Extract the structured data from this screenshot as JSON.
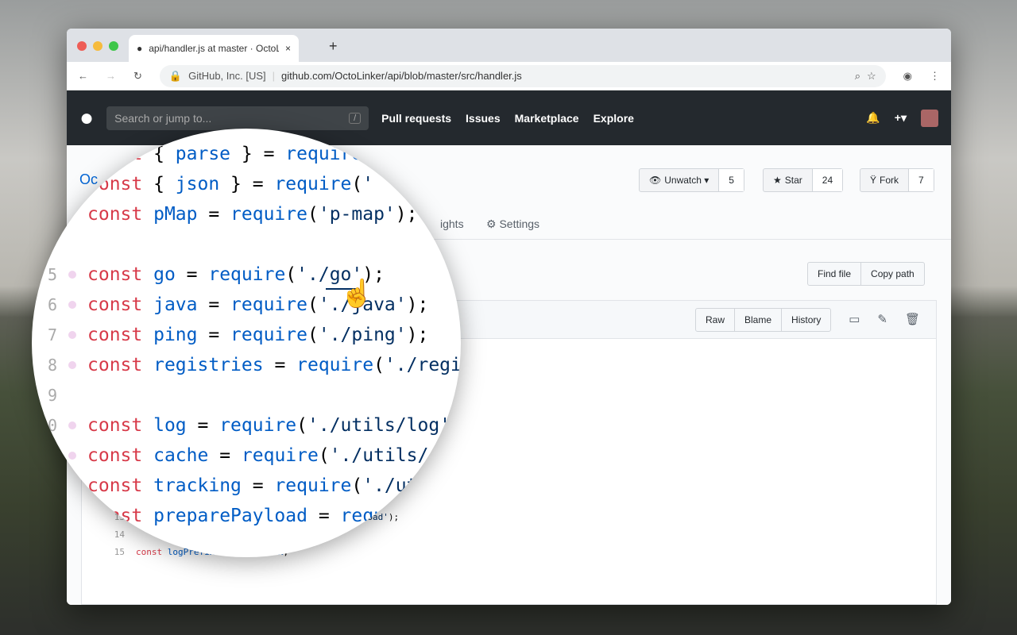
{
  "browser": {
    "tab_title": "api/handler.js at master · OctoLinker",
    "new_tab": "+",
    "close": "×",
    "site_identity": "GitHub, Inc. [US]",
    "url": "github.com/OctoLinker/api/blob/master/src/handler.js"
  },
  "github": {
    "search_placeholder": "Search or jump to...",
    "search_key": "/",
    "nav": [
      "Pull requests",
      "Issues",
      "Marketplace",
      "Explore"
    ],
    "plus": "+▾"
  },
  "repo": {
    "owner_partial": "Oc",
    "watch": {
      "label": "Unwatch ▾",
      "count": "5"
    },
    "star": {
      "label": "Star",
      "count": "24"
    },
    "fork": {
      "label": "Fork",
      "count": "7"
    },
    "tabs": {
      "insights_partial": "ights",
      "settings": "Settings"
    },
    "find_file": "Find file",
    "copy_path": "Copy path",
    "raw": "Raw",
    "blame": "Blame",
    "history": "History"
  },
  "code_small": [
    {
      "n": "11",
      "code": ""
    },
    {
      "n": "12",
      "code": "const tracking = require('./utils/tracking');"
    },
    {
      "n": "13",
      "code": "const preparePayload = require('./utils/payload');"
    },
    {
      "n": "14",
      "code": ""
    },
    {
      "n": "15",
      "code": "const logPrefix = log.prefix;"
    }
  ],
  "code_magnified": [
    {
      "n": "",
      "code": "const { parse } = require('"
    },
    {
      "n": "",
      "code": "const { json } = require('"
    },
    {
      "n": "",
      "code": "const pMap = require('p-map');"
    },
    {
      "n": "",
      "code": ""
    },
    {
      "n": "5",
      "code": "const go = require('./go');"
    },
    {
      "n": "6",
      "code": "const java = require('./java');"
    },
    {
      "n": "7",
      "code": "const ping = require('./ping');"
    },
    {
      "n": "8",
      "code": "const registries = require('./registries');"
    },
    {
      "n": "9",
      "code": ""
    },
    {
      "n": "10",
      "code": "const log = require('./utils/log');"
    },
    {
      "n": "11",
      "code": "const cache = require('./utils/cache');"
    },
    {
      "n": "12",
      "code": "const tracking = require('./utils/tracking');"
    },
    {
      "n": "13",
      "code": "const preparePayload = require('./utils/payload');"
    }
  ]
}
